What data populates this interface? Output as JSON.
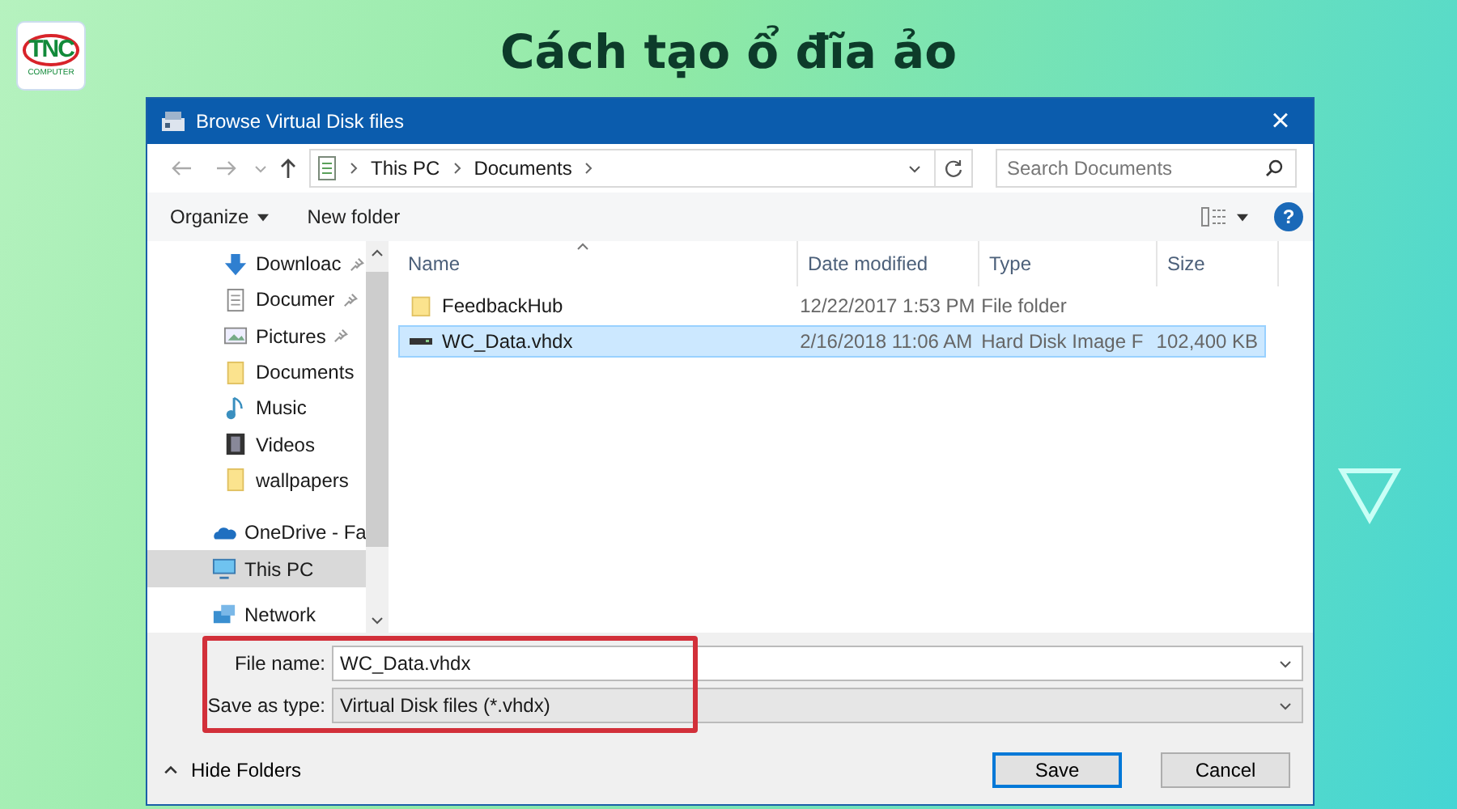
{
  "logo": {
    "text": "TNC",
    "subtext": "COMPUTER"
  },
  "headline": "Cách tạo ổ đĩa ảo",
  "window": {
    "title": "Browse Virtual Disk files",
    "close": "×"
  },
  "address": {
    "path": [
      "This PC",
      "Documents"
    ],
    "search_placeholder": "Search Documents"
  },
  "toolbar": {
    "organize": "Organize",
    "new_folder": "New folder",
    "help": "?"
  },
  "sidebar": {
    "items": [
      {
        "label": "Downloac",
        "kind": "download",
        "pinned": true,
        "selected": false
      },
      {
        "label": "Documer",
        "kind": "document",
        "pinned": true,
        "selected": false
      },
      {
        "label": "Pictures",
        "kind": "picture",
        "pinned": true,
        "selected": false
      },
      {
        "label": "Documents",
        "kind": "folder",
        "pinned": false,
        "selected": false
      },
      {
        "label": "Music",
        "kind": "music",
        "pinned": false,
        "selected": false
      },
      {
        "label": "Videos",
        "kind": "video",
        "pinned": false,
        "selected": false
      },
      {
        "label": "wallpapers",
        "kind": "folder",
        "pinned": false,
        "selected": false
      },
      {
        "label": "OneDrive - Fa",
        "kind": "cloud",
        "pinned": false,
        "selected": false
      },
      {
        "label": "This PC",
        "kind": "pc",
        "pinned": false,
        "selected": true
      },
      {
        "label": "Network",
        "kind": "network",
        "pinned": false,
        "selected": false
      }
    ]
  },
  "table": {
    "columns": [
      "Name",
      "Date modified",
      "Type",
      "Size"
    ],
    "rows": [
      {
        "name": "FeedbackHub",
        "kind": "folder",
        "date": "12/22/2017 1:53 PM",
        "type": "File folder",
        "selected": false
      },
      {
        "name": "WC_Data.vhdx",
        "kind": "disk",
        "date": "2/16/2018 11:06 AM",
        "type": "Hard Disk Image F",
        "size": "102,400 KB",
        "selected": true
      }
    ]
  },
  "form": {
    "file_name_label": "File name:",
    "file_name": "WC_Data.vhdx",
    "type_label": "Save as type:",
    "type_value": "Virtual Disk files (*.vhdx)",
    "highlighted": true
  },
  "footer": {
    "hide_folders": "Hide Folders",
    "save": "Save",
    "cancel": "Cancel"
  }
}
